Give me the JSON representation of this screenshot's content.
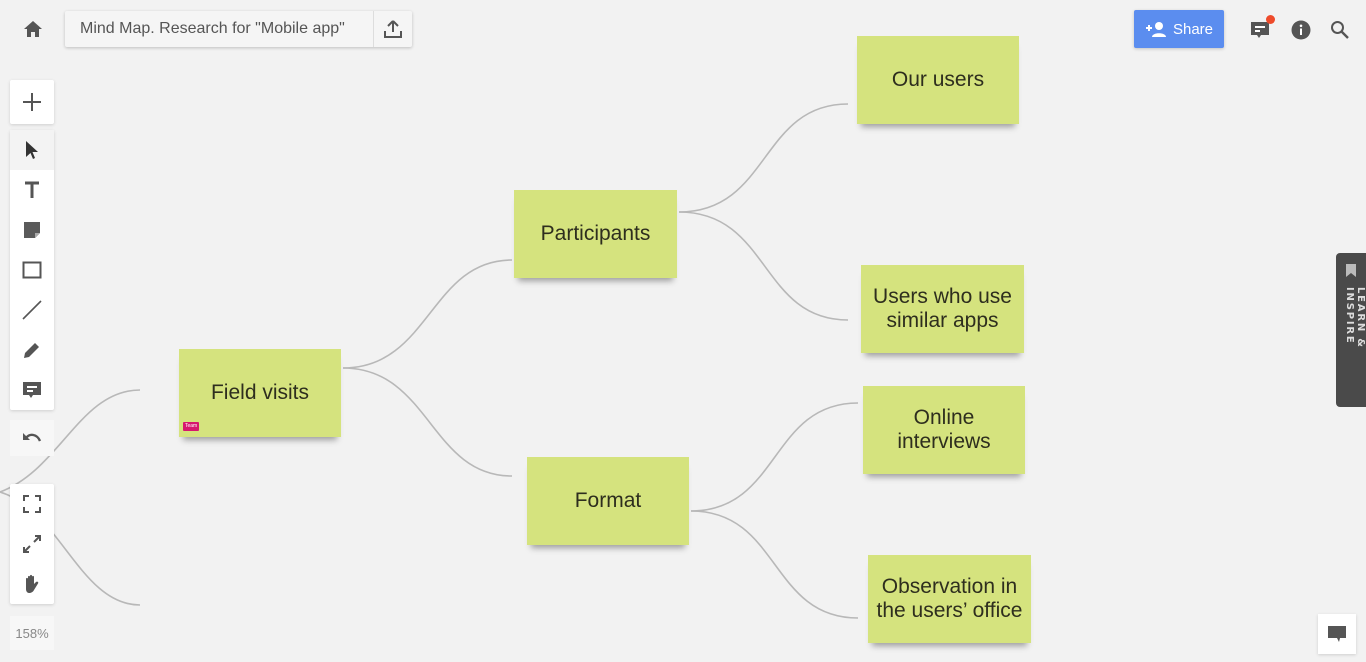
{
  "header": {
    "board_title": "Mind Map. Research for \"Mobile app\"",
    "share_label": "Share",
    "icons": [
      "home-icon",
      "export-icon",
      "add-user-icon",
      "comments-icon",
      "info-icon",
      "search-icon"
    ],
    "notification_color": "#ee4b2b",
    "share_color": "#5b8def"
  },
  "toolbar": {
    "tools": [
      {
        "name": "add",
        "icon": "plus-icon"
      },
      {
        "name": "select",
        "icon": "cursor-icon",
        "active": true
      },
      {
        "name": "text",
        "icon": "text-icon"
      },
      {
        "name": "sticky-note",
        "icon": "sticky-note-icon"
      },
      {
        "name": "shape",
        "icon": "rectangle-icon"
      },
      {
        "name": "line",
        "icon": "line-icon"
      },
      {
        "name": "pen",
        "icon": "pen-icon"
      },
      {
        "name": "comment",
        "icon": "comment-icon"
      },
      {
        "name": "undo",
        "icon": "undo-icon"
      },
      {
        "name": "fit-to-screen",
        "icon": "frame-icon"
      },
      {
        "name": "fullscreen",
        "icon": "expand-icon"
      },
      {
        "name": "pan",
        "icon": "hand-icon"
      }
    ],
    "zoom_level": "158%"
  },
  "mindmap": {
    "sticky_color": "#d5e37e",
    "nodes": [
      {
        "id": "field-visits",
        "text": "Field visits",
        "tag": "Team"
      },
      {
        "id": "participants",
        "text": "Participants"
      },
      {
        "id": "format",
        "text": "Format"
      },
      {
        "id": "our-users",
        "text": "Our users"
      },
      {
        "id": "similar-apps-users",
        "text": "Users who use similar apps"
      },
      {
        "id": "online-interviews",
        "text": "Online interviews"
      },
      {
        "id": "observation",
        "text": "Observation in the users’ office"
      }
    ],
    "edges": [
      [
        "field-visits",
        "participants"
      ],
      [
        "field-visits",
        "format"
      ],
      [
        "participants",
        "our-users"
      ],
      [
        "participants",
        "similar-apps-users"
      ],
      [
        "format",
        "online-interviews"
      ],
      [
        "format",
        "observation"
      ]
    ]
  },
  "side_panel": {
    "learn_label": "LEARN & INSPIRE"
  }
}
